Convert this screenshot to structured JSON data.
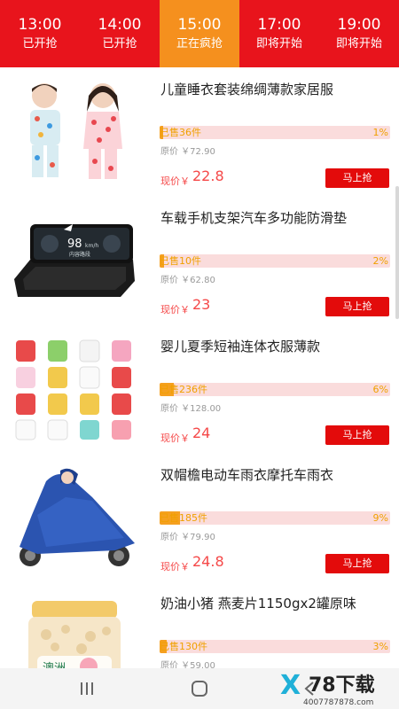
{
  "tabs": [
    {
      "time": "13:00",
      "status": "已开抢",
      "active": false
    },
    {
      "time": "14:00",
      "status": "已开抢",
      "active": false
    },
    {
      "time": "15:00",
      "status": "正在疯抢",
      "active": true
    },
    {
      "time": "17:00",
      "status": "即将开始",
      "active": false
    },
    {
      "time": "19:00",
      "status": "即将开始",
      "active": false
    }
  ],
  "products": [
    {
      "title": "儿童睡衣套装绵绸薄款家居服",
      "sold": "已售36件",
      "percent": "1%",
      "progress": 0.01,
      "original": "原价 ￥72.90",
      "now_label": "现价￥",
      "now_price": "22.8",
      "buy": "马上抢"
    },
    {
      "title": "车载手机支架汽车多功能防滑垫",
      "sold": "已售10件",
      "percent": "2%",
      "progress": 0.02,
      "original": "原价 ￥62.80",
      "now_label": "现价￥",
      "now_price": "23",
      "buy": "马上抢",
      "image_text": {
        "big": "98",
        "unit": "km/h",
        "small": "内容路段"
      }
    },
    {
      "title": "婴儿夏季短袖连体衣服薄款",
      "sold": "已售236件",
      "percent": "6%",
      "progress": 0.06,
      "original": "原价 ￥128.00",
      "now_label": "现价￥",
      "now_price": "24",
      "buy": "马上抢"
    },
    {
      "title": "双帽檐电动车雨衣摩托车雨衣",
      "sold": "已售185件",
      "percent": "9%",
      "progress": 0.09,
      "original": "原价 ￥79.90",
      "now_label": "现价￥",
      "now_price": "24.8",
      "buy": "马上抢"
    },
    {
      "title": "奶油小猪 燕麦片1150gx2罐原味",
      "sold": "已售130件",
      "percent": "3%",
      "progress": 0.03,
      "original": "原价 ￥59.00",
      "now_label": "现价￥",
      "now_price": "",
      "buy": "",
      "image_text": {
        "label": "澳洲"
      }
    }
  ],
  "watermark": {
    "big": "78下载",
    "small": "4007787878.com",
    "x": "X"
  },
  "colors": {
    "tab_bar": "#e8141c",
    "tab_active": "#f5901e",
    "price": "#f54848",
    "buy_button": "#e30b0b",
    "progress_fill": "#f5a020",
    "progress_track": "#fadcdc",
    "sold_text": "#f0a000"
  },
  "icons": {
    "nav_recent": "recent-apps-icon",
    "nav_home": "home-circle-icon",
    "nav_back": "back-arrow-icon"
  }
}
